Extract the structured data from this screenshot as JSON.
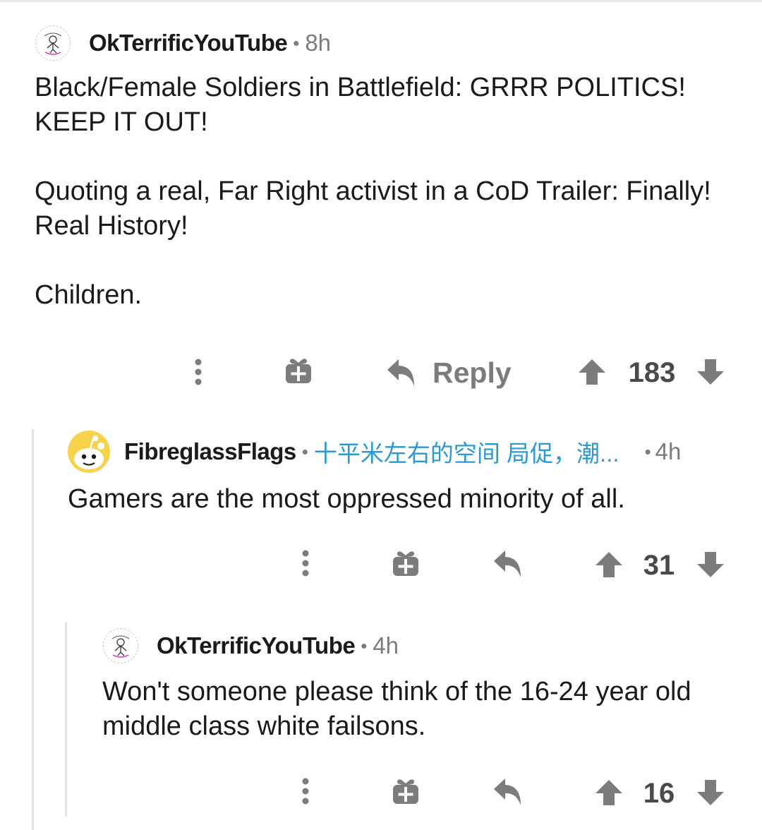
{
  "comments": [
    {
      "username": "OkTerrificYouTube",
      "separator": "•",
      "time": "8h",
      "body": [
        "Black/Female Soldiers in Battlefield: GRRR POLITICS! KEEP IT OUT!",
        "Quoting a real, Far Right activist in a CoD Trailer: Finally! Real History!",
        "Children."
      ],
      "score": "183",
      "reply_label": "Reply",
      "avatar_icon": "sketch-avatar-icon"
    },
    {
      "username": "FibreglassFlags",
      "separator": "•",
      "flair": "十平米左右的空间 局促，潮...",
      "time_separator": "•",
      "time": "4h",
      "body": [
        "Gamers are the most oppressed minority of all."
      ],
      "score": "31",
      "avatar_icon": "snoo-avatar-icon"
    },
    {
      "username": "OkTerrificYouTube",
      "separator": "•",
      "time": "4h",
      "body": [
        "Won't someone please think of the 16-24 year old middle class white failsons."
      ],
      "score": "16",
      "avatar_icon": "sketch-avatar-icon"
    }
  ],
  "icons": {
    "more": "more-options-icon",
    "award": "award-gift-icon",
    "reply": "reply-arrow-icon",
    "upvote": "upvote-arrow-icon",
    "downvote": "downvote-arrow-icon"
  },
  "colors": {
    "action_gray": "#7c7c7c",
    "flair_blue": "#2a9ad6",
    "snoo_yellow": "#f6d34a",
    "thread_line": "#e3e3e3"
  }
}
